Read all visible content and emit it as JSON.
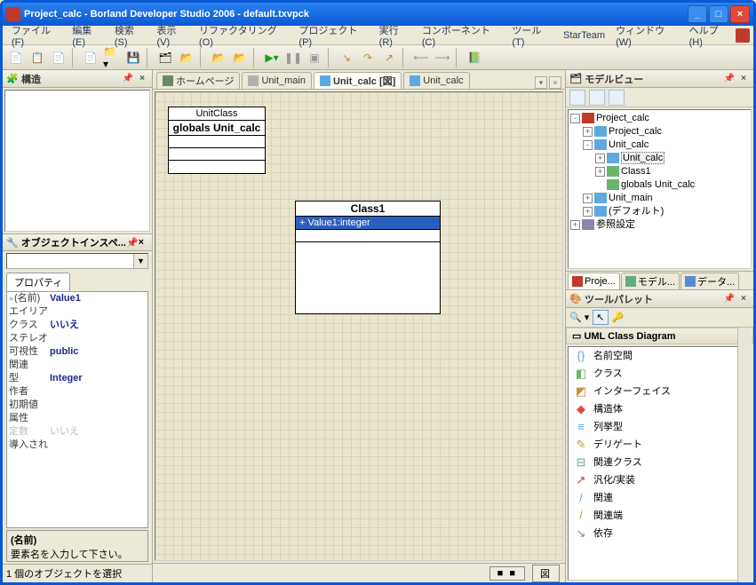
{
  "title": "Project_calc - Borland Developer Studio 2006 - default.txvpck",
  "winbtns": {
    "min": "_",
    "max": "□",
    "close": "×"
  },
  "menu": [
    "ファイル(F)",
    "編集(E)",
    "検索(S)",
    "表示(V)",
    "リファクタリング(O)",
    "プロジェクト(P)",
    "実行(R)",
    "コンポーネント(C)",
    "ツール(T)",
    "StarTeam",
    "ウィンドウ(W)",
    "ヘルプ(H)"
  ],
  "panels": {
    "structure": {
      "title": "構造",
      "pin": "📌",
      "close": "×"
    },
    "inspector": {
      "title": "オブジェクトインスペ...",
      "tab": "プロパティ",
      "rows": [
        {
          "k": "(名前)",
          "v": "Value1",
          "expand": true,
          "bold": true
        },
        {
          "k": "エイリア",
          "v": ""
        },
        {
          "k": "クラス",
          "v": "いいえ",
          "bold": true
        },
        {
          "k": "ステレオ",
          "v": ""
        },
        {
          "k": "可視性",
          "v": "public",
          "bold": true
        },
        {
          "k": "関連",
          "v": ""
        },
        {
          "k": "型",
          "v": "Integer",
          "bold": true
        },
        {
          "k": "作者",
          "v": ""
        },
        {
          "k": "初期値",
          "v": ""
        },
        {
          "k": "属性",
          "v": ""
        },
        {
          "k": "定数",
          "v": "いいえ",
          "disabled": true
        },
        {
          "k": "導入され",
          "v": ""
        }
      ],
      "desc_title": "(名前)",
      "desc_text": "要素名を入力して下さい。",
      "status": "1 個のオブジェクトを選択"
    },
    "modelview": {
      "title": "モデルビュー",
      "tree": [
        {
          "ind": 0,
          "tw": "-",
          "icon": "#c0392b",
          "label": "Project_calc"
        },
        {
          "ind": 1,
          "tw": "+",
          "icon": "#5da9e0",
          "label": "Project_calc"
        },
        {
          "ind": 1,
          "tw": "-",
          "icon": "#5da9e0",
          "label": "Unit_calc"
        },
        {
          "ind": 2,
          "tw": "+",
          "icon": "#5da9e0",
          "label": "Unit_calc",
          "sel": true
        },
        {
          "ind": 2,
          "tw": "+",
          "icon": "#69b56c",
          "label": "Class1"
        },
        {
          "ind": 2,
          "tw": "",
          "icon": "#69b56c",
          "label": "globals Unit_calc"
        },
        {
          "ind": 1,
          "tw": "+",
          "icon": "#5da9e0",
          "label": "Unit_main"
        },
        {
          "ind": 1,
          "tw": "+",
          "icon": "#5da9e0",
          "label": "(デフォルト)"
        },
        {
          "ind": 0,
          "tw": "+",
          "icon": "#88a",
          "label": "参照設定"
        }
      ],
      "tabs": [
        {
          "label": "Proje...",
          "active": true,
          "color": "#c0392b"
        },
        {
          "label": "モデル...",
          "color": "#6a8"
        },
        {
          "label": "データ...",
          "color": "#5a8ad0"
        }
      ]
    },
    "palette": {
      "title": "ツールパレット",
      "category": "UML Class Diagram",
      "items": [
        {
          "icon": "{}",
          "color": "#5da9e0",
          "label": "名前空間"
        },
        {
          "icon": "◧",
          "color": "#69b56c",
          "label": "クラス"
        },
        {
          "icon": "◩",
          "color": "#c98f3a",
          "label": "インターフェイス"
        },
        {
          "icon": "◆",
          "color": "#e04a3a",
          "label": "構造体"
        },
        {
          "icon": "≡",
          "color": "#5da9e0",
          "label": "列挙型"
        },
        {
          "icon": "✎",
          "color": "#c49a3a",
          "label": "デリゲート"
        },
        {
          "icon": "⊟",
          "color": "#6a8",
          "label": "関連クラス"
        },
        {
          "icon": "↗",
          "color": "#c0392b",
          "label": "汎化/実装"
        },
        {
          "icon": "/",
          "color": "#5da9e0",
          "label": "関連"
        },
        {
          "icon": "/",
          "color": "#c49a3a",
          "label": "関連端"
        },
        {
          "icon": "↘",
          "color": "#888",
          "label": "依存"
        }
      ]
    }
  },
  "doctabs": [
    {
      "icon": "#6a8860",
      "label": "ホームページ"
    },
    {
      "icon": "#b0b0b0",
      "label": "Unit_main"
    },
    {
      "icon": "#5da9e0",
      "label": "Unit_calc [図]",
      "active": true
    },
    {
      "icon": "#5da9e0",
      "label": "Unit_calc"
    }
  ],
  "canvas": {
    "box1": {
      "title": "UnitClass",
      "name": "globals Unit_calc"
    },
    "box2": {
      "name": "Class1",
      "item": "+ Value1:integer"
    }
  },
  "bottom_buttons": [
    "■ ■",
    "図"
  ]
}
